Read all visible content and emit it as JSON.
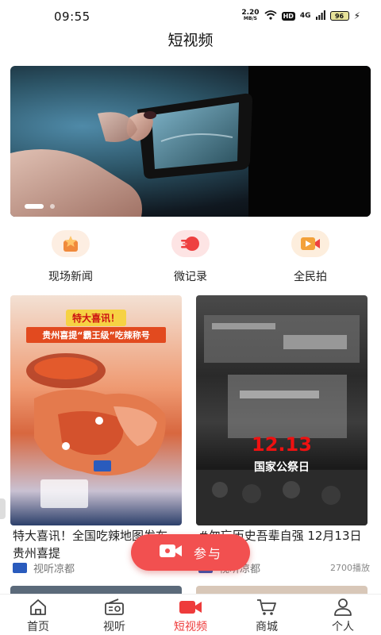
{
  "status": {
    "time": "09:55",
    "net_speed": "2.20",
    "net_unit": "MB/S",
    "hd": "HD",
    "signal": "4G",
    "battery": "96"
  },
  "header": {
    "title": "短视频"
  },
  "banner": {
    "slide_count": 2,
    "active_index": 0
  },
  "categories": [
    {
      "label": "现场新闻",
      "icon": "star-badge-icon",
      "color": "#f08a3c"
    },
    {
      "label": "微记录",
      "icon": "speed-record-icon",
      "color": "#ee4040"
    },
    {
      "label": "全民拍",
      "icon": "video-play-icon",
      "color": "#f3a13a"
    }
  ],
  "cards": [
    {
      "poster_tag": "特大喜讯！",
      "poster_line": "贵州喜提“霸王级”吃辣称号",
      "title": "特大喜讯！全国吃辣地图发布，贵州喜提",
      "source": "视听凉都",
      "plays": ""
    },
    {
      "poster_date": "12.13",
      "poster_sub": "国家公祭日",
      "title": "#勿忘历史吾辈自强 12月13日是第…",
      "source": "视听凉都",
      "plays": "2700播放"
    }
  ],
  "fab": {
    "label": "参与",
    "icon": "camera-icon"
  },
  "tabs": [
    {
      "label": "首页",
      "icon": "home-icon",
      "active": false
    },
    {
      "label": "视听",
      "icon": "radio-icon",
      "active": false
    },
    {
      "label": "短视频",
      "icon": "video-camera-icon",
      "active": true
    },
    {
      "label": "商城",
      "icon": "cart-icon",
      "active": false
    },
    {
      "label": "个人",
      "icon": "person-icon",
      "active": false
    }
  ],
  "colors": {
    "accent": "#ee3b3b",
    "fab": "#f25050"
  }
}
